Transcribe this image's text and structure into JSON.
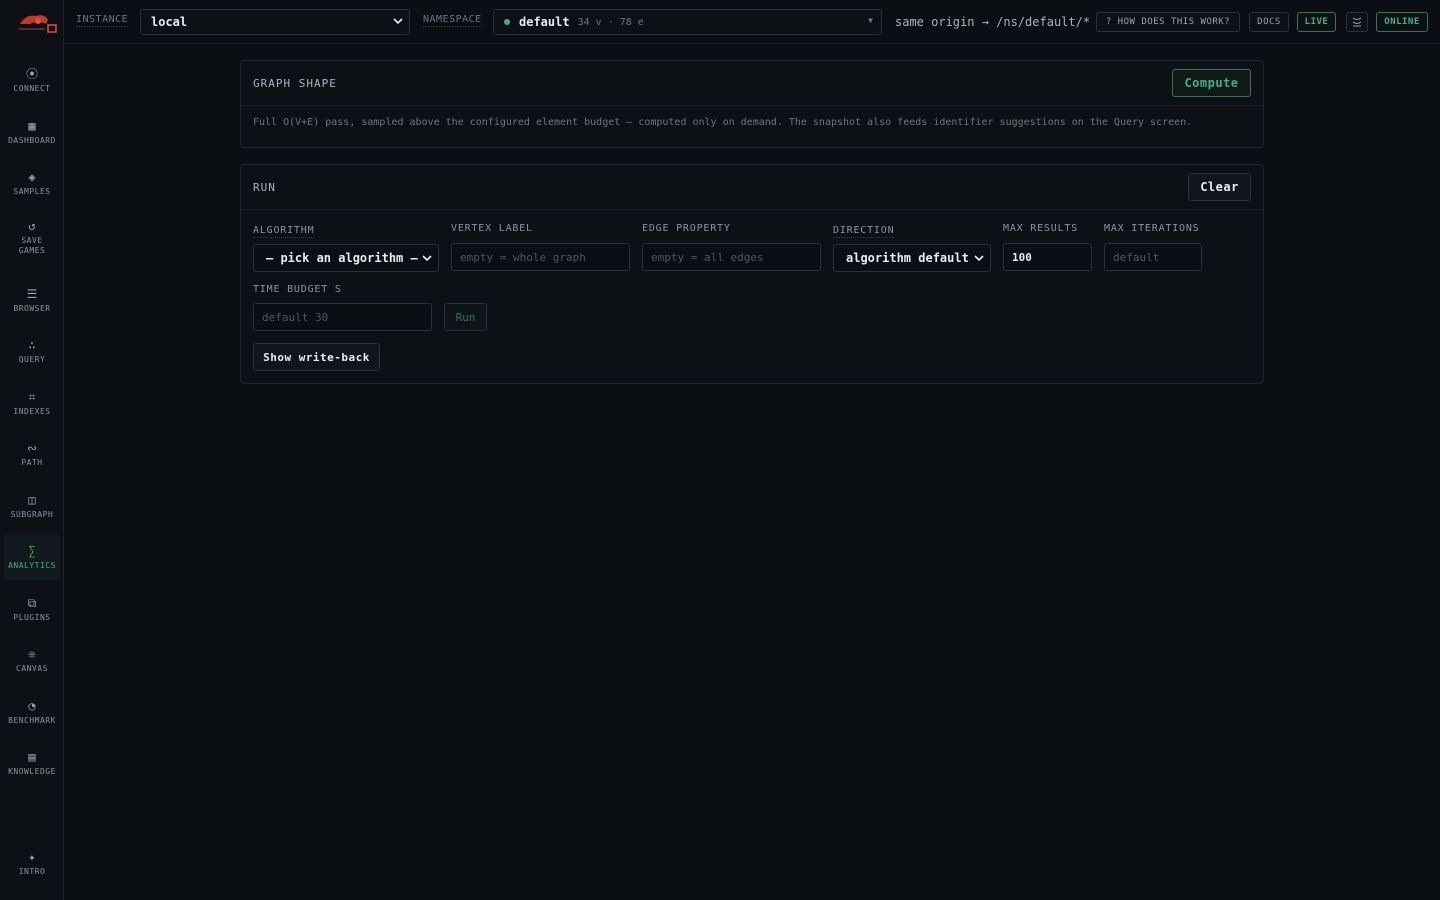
{
  "sidebar": {
    "items": [
      {
        "icon": "connect-icon",
        "glyph": "⦿",
        "label": "CONNECT"
      },
      {
        "icon": "dashboard-icon",
        "glyph": "▦",
        "label": "DASHBOARD"
      },
      {
        "icon": "samples-icon",
        "glyph": "◈",
        "label": "SAMPLES"
      },
      {
        "icon": "save-games-icon",
        "glyph": "↺",
        "label": "SAVE GAMES"
      },
      {
        "icon": "browser-icon",
        "glyph": "☰",
        "label": "BROWSER"
      },
      {
        "icon": "query-icon",
        "glyph": "∴",
        "label": "QUERY"
      },
      {
        "icon": "indexes-icon",
        "glyph": "⌗",
        "label": "INDEXES"
      },
      {
        "icon": "path-icon",
        "glyph": "∾",
        "label": "PATH"
      },
      {
        "icon": "subgraph-icon",
        "glyph": "◫",
        "label": "SUBGRAPH"
      },
      {
        "icon": "analytics-icon",
        "glyph": "∑",
        "label": "ANALYTICS"
      },
      {
        "icon": "plugins-icon",
        "glyph": "⧉",
        "label": "PLUGINS"
      },
      {
        "icon": "canvas-icon",
        "glyph": "❊",
        "label": "CANVAS"
      },
      {
        "icon": "benchmark-icon",
        "glyph": "◔",
        "label": "BENCHMARK"
      },
      {
        "icon": "knowledge-icon",
        "glyph": "▤",
        "label": "KNOWLEDGE"
      }
    ],
    "intro": {
      "icon": "intro-icon",
      "glyph": "✦",
      "label": "INTRO"
    },
    "active": "ANALYTICS"
  },
  "topbar": {
    "instance_label": "INSTANCE",
    "instance_value": "local",
    "namespace_label": "NAMESPACE",
    "namespace_value": "default",
    "namespace_meta": "34 v · 78 e",
    "origin": "same origin → /ns/default/*",
    "help": "? HOW DOES THIS WORK?",
    "docs": "DOCS",
    "live": "LIVE",
    "online": "ONLINE",
    "accent_color": "#3fb37f"
  },
  "graph_shape": {
    "title": "GRAPH SHAPE",
    "compute_label": "Compute",
    "description": "Full O(V+E) pass, sampled above the configured element budget — computed only on demand. The snapshot also feeds identifier suggestions on the Query screen."
  },
  "run": {
    "title": "RUN",
    "clear_label": "Clear",
    "algorithm_label": "ALGORITHM",
    "algorithm_value": "— pick an algorithm —",
    "vertex_label_label": "VERTEX LABEL",
    "vertex_label_placeholder": "empty = whole graph",
    "edge_property_label": "EDGE PROPERTY",
    "edge_property_placeholder": "empty = all edges",
    "direction_label": "DIRECTION",
    "direction_value": "algorithm default",
    "max_results_label": "MAX RESULTS",
    "max_results_value": "100",
    "max_iterations_label": "MAX ITERATIONS",
    "max_iterations_placeholder": "default",
    "time_budget_label": "TIME BUDGET S",
    "time_budget_placeholder": "default 30",
    "run_label": "Run",
    "write_back_label": "Show write-back"
  }
}
